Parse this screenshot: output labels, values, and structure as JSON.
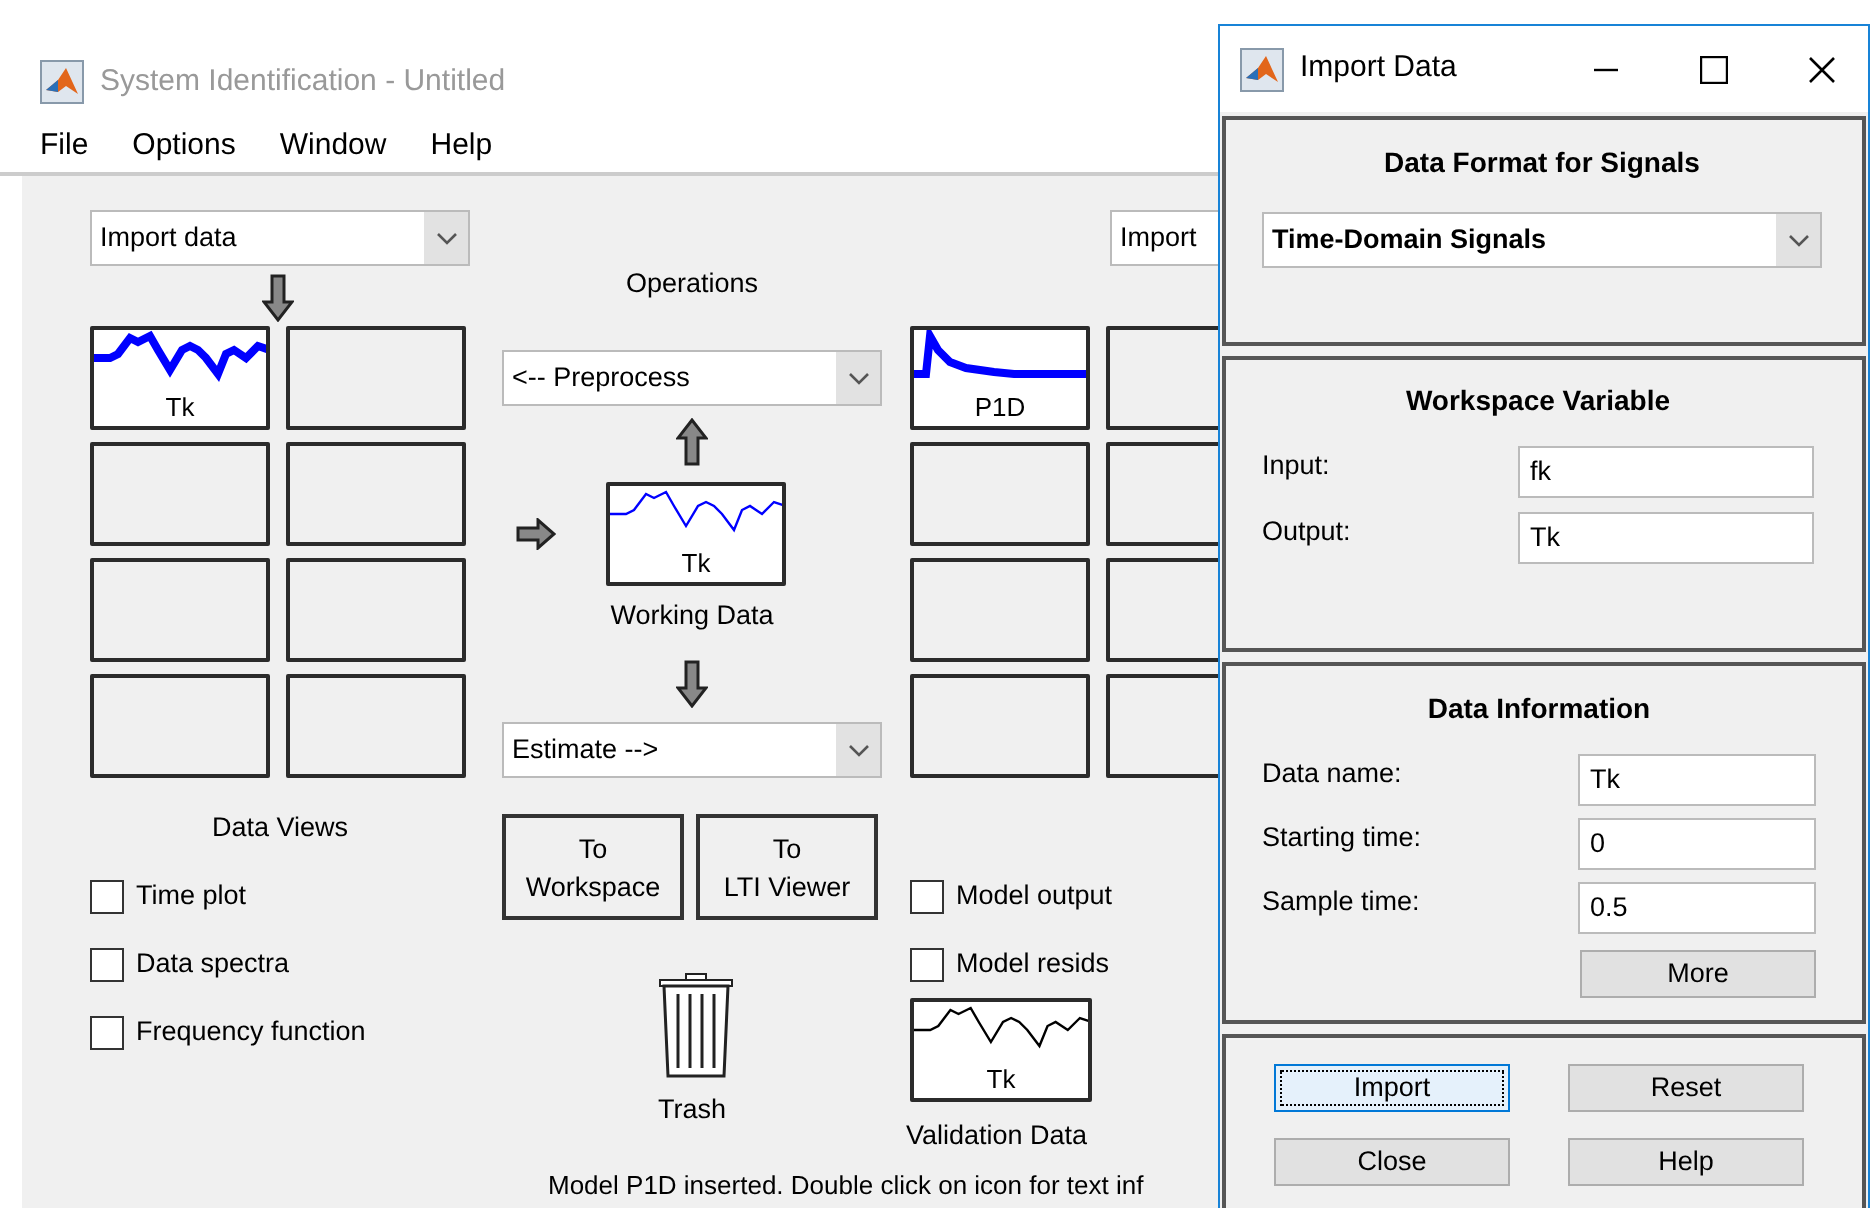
{
  "window": {
    "title": "System Identification - Untitled"
  },
  "menu": [
    "File",
    "Options",
    "Window",
    "Help"
  ],
  "data_panel": {
    "dropdown": "Import data",
    "views": [
      {
        "kind": "data",
        "label": "Tk"
      },
      {
        "kind": "empty"
      },
      {
        "kind": "empty"
      },
      {
        "kind": "empty"
      },
      {
        "kind": "empty"
      },
      {
        "kind": "empty"
      },
      {
        "kind": "empty"
      },
      {
        "kind": "empty"
      }
    ],
    "title": "Data Views",
    "checkboxes": [
      {
        "label": "Time plot",
        "checked": false
      },
      {
        "label": "Data spectra",
        "checked": false
      },
      {
        "label": "Frequency function",
        "checked": false
      }
    ]
  },
  "operations": {
    "title": "Operations",
    "preprocess": "<-- Preprocess",
    "working_data": {
      "label": "Tk"
    },
    "working_title": "Working Data",
    "estimate": "Estimate -->",
    "buttons": [
      [
        "To",
        "Workspace"
      ],
      [
        "To",
        "LTI Viewer"
      ]
    ],
    "trash": "Trash"
  },
  "model_panel": {
    "dropdown": "Import",
    "views": [
      {
        "kind": "model",
        "label": "P1D"
      },
      {
        "kind": "empty"
      },
      {
        "kind": "empty"
      },
      {
        "kind": "empty"
      },
      {
        "kind": "empty"
      },
      {
        "kind": "empty"
      },
      {
        "kind": "empty"
      },
      {
        "kind": "empty"
      }
    ],
    "checkboxes": [
      {
        "label": "Model output",
        "checked": false
      },
      {
        "label": "Model resids",
        "checked": false
      }
    ],
    "validation": {
      "label": "Tk"
    },
    "validation_title": "Validation Data"
  },
  "status": "Model P1D inserted. Double click on icon for text inf",
  "dialog": {
    "title": "Import Data",
    "format": {
      "title": "Data Format for Signals",
      "value": "Time-Domain Signals"
    },
    "workspace": {
      "title": "Workspace Variable",
      "fields": [
        {
          "label": "Input:",
          "value": "fk"
        },
        {
          "label": "Output:",
          "value": "Tk"
        }
      ]
    },
    "info": {
      "title": "Data Information",
      "fields": [
        {
          "label": "Data name:",
          "value": "Tk"
        },
        {
          "label": "Starting time:",
          "value": "0"
        },
        {
          "label": "Sample time:",
          "value": "0.5"
        }
      ],
      "more": "More"
    },
    "buttons": [
      {
        "label": "Import",
        "focused": true
      },
      {
        "label": "Reset",
        "focused": false
      },
      {
        "label": "Close",
        "focused": false
      },
      {
        "label": "Help",
        "focused": false
      }
    ]
  }
}
